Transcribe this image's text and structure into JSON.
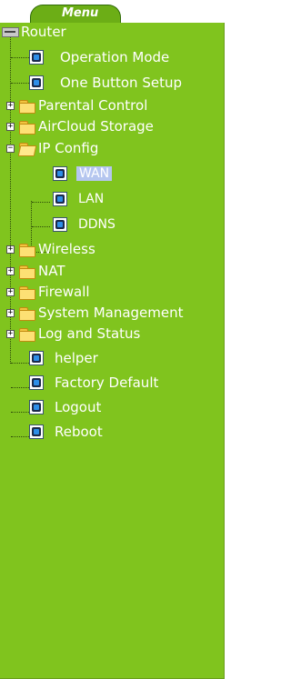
{
  "menu": {
    "title": "Menu"
  },
  "tree": {
    "root": {
      "label": "Router"
    },
    "items": [
      {
        "label": "Operation Mode",
        "type": "page"
      },
      {
        "label": "One Button Setup",
        "type": "page"
      },
      {
        "label": "Parental Control",
        "type": "folder",
        "expanded": false
      },
      {
        "label": "AirCloud Storage",
        "type": "folder",
        "expanded": false
      },
      {
        "label": "IP Config",
        "type": "folder",
        "expanded": true,
        "children": [
          {
            "label": "WAN",
            "selected": true
          },
          {
            "label": "LAN"
          },
          {
            "label": "DDNS"
          }
        ]
      },
      {
        "label": "Wireless",
        "type": "folder",
        "expanded": false
      },
      {
        "label": "NAT",
        "type": "folder",
        "expanded": false
      },
      {
        "label": "Firewall",
        "type": "folder",
        "expanded": false
      },
      {
        "label": "System Management",
        "type": "folder",
        "expanded": false
      },
      {
        "label": "Log and Status",
        "type": "folder",
        "expanded": false
      },
      {
        "label": "helper",
        "type": "page"
      },
      {
        "label": "Factory Default",
        "type": "page"
      },
      {
        "label": "Logout",
        "type": "page"
      },
      {
        "label": "Reboot",
        "type": "page"
      }
    ]
  },
  "colors": {
    "panel": "#80c41e",
    "tab": "#6cae16",
    "selected": "#b5c6ef",
    "text": "#ffffff"
  }
}
